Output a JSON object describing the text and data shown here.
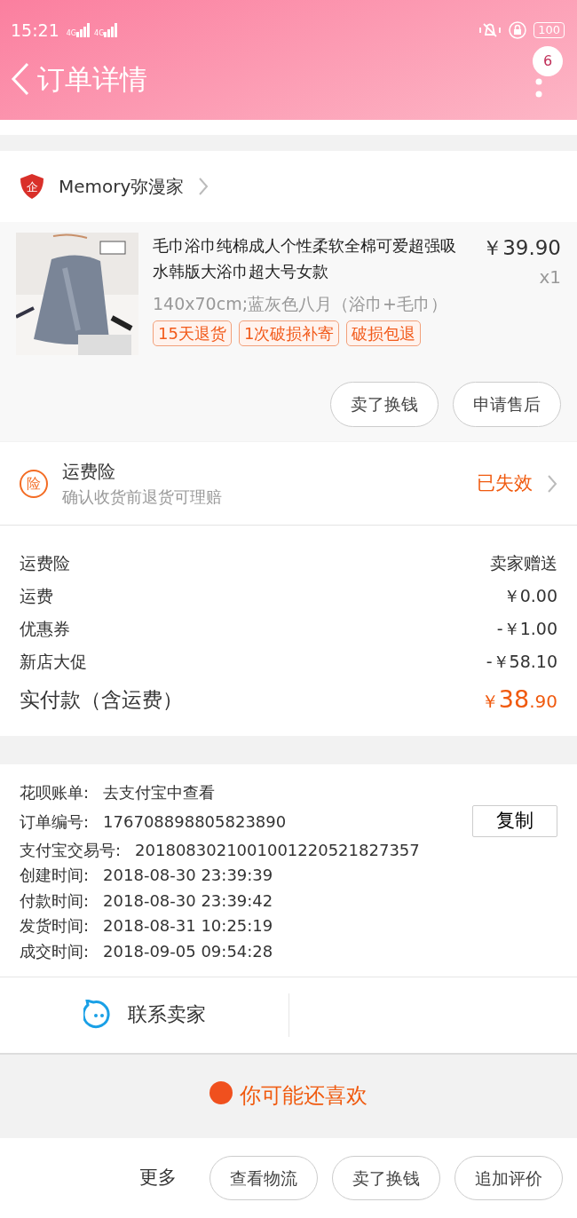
{
  "status_bar": {
    "time": "15:21",
    "networks": [
      "4G",
      "4G"
    ],
    "battery": "100"
  },
  "header": {
    "title": "订单详情",
    "badge": "6"
  },
  "shop": {
    "name": "Memory弥漫家",
    "badge_char": "企"
  },
  "product": {
    "title": "毛巾浴巾纯棉成人个性柔软全棉可爱超强吸水韩版大浴巾超大号女款",
    "price": "￥39.90",
    "quantity": "x1",
    "sku": "140x70cm;蓝灰色八月（浴巾+毛巾）",
    "tags": [
      "15天退货",
      "1次破损补寄",
      "破损包退"
    ],
    "buttons": [
      "卖了换钱",
      "申请售后"
    ]
  },
  "insurance": {
    "icon_char": "险",
    "title": "运费险",
    "subtitle": "确认收货前退货可理赔",
    "status": "已失效"
  },
  "fees": [
    {
      "label": "运费险",
      "value": "卖家赠送"
    },
    {
      "label": "运费",
      "value": "￥0.00"
    },
    {
      "label": "优惠券",
      "value": "-￥1.00"
    },
    {
      "label": "新店大促",
      "value": "-￥58.10"
    }
  ],
  "total": {
    "label": "实付款（含运费）",
    "currency": "￥",
    "integer": "38",
    "decimal": ".90"
  },
  "info": [
    {
      "label": "花呗账单:",
      "value": "去支付宝中查看"
    },
    {
      "label": "订单编号:",
      "value": "176708898805823890",
      "action": "复制"
    },
    {
      "label": "支付宝交易号:",
      "value": "2018083021001001220521827357"
    },
    {
      "label": "创建时间:",
      "value": "2018-08-30 23:39:39"
    },
    {
      "label": "付款时间:",
      "value": "2018-08-30 23:39:42"
    },
    {
      "label": "发货时间:",
      "value": "2018-08-31 10:25:19"
    },
    {
      "label": "成交时间:",
      "value": "2018-09-05 09:54:28"
    }
  ],
  "contact": {
    "label": "联系卖家"
  },
  "recommend": {
    "title": "你可能还喜欢"
  },
  "bottom_bar": {
    "more": "更多",
    "buttons": [
      "查看物流",
      "卖了换钱",
      "追加评价"
    ]
  }
}
